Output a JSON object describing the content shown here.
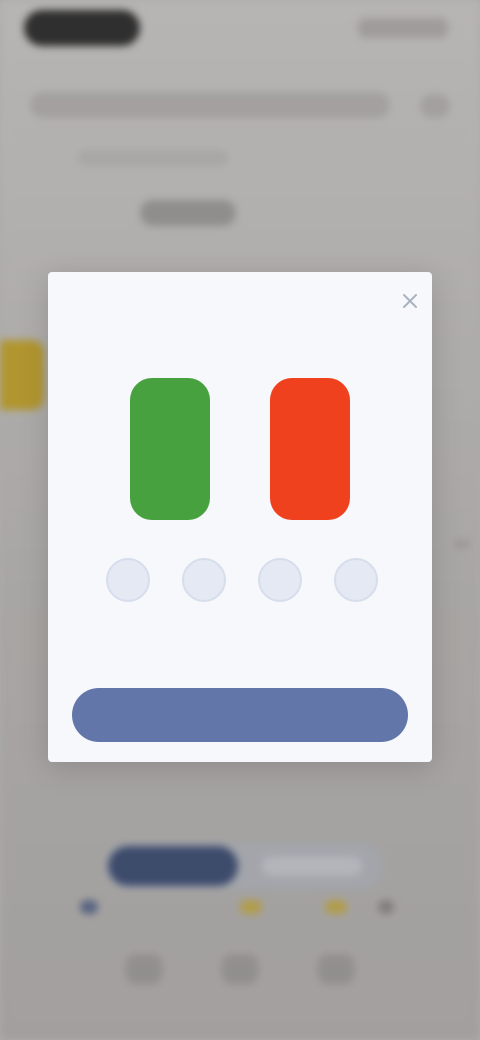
{
  "background": {
    "accent_tag_color": "#c8a72a",
    "segment_active_color": "#3c4d75"
  },
  "dialog": {
    "title": "",
    "close_icon": "close-icon",
    "candles": [
      {
        "color": "#47a13f",
        "label": ""
      },
      {
        "color": "#f0411f",
        "label": ""
      }
    ],
    "options": [
      {
        "icon": "circle-icon",
        "label": ""
      },
      {
        "icon": "circle-icon",
        "label": ""
      },
      {
        "icon": "circle-icon",
        "label": ""
      },
      {
        "icon": "circle-icon",
        "label": ""
      }
    ],
    "primary_button_label": "",
    "primary_button_color": "#6376aa"
  }
}
